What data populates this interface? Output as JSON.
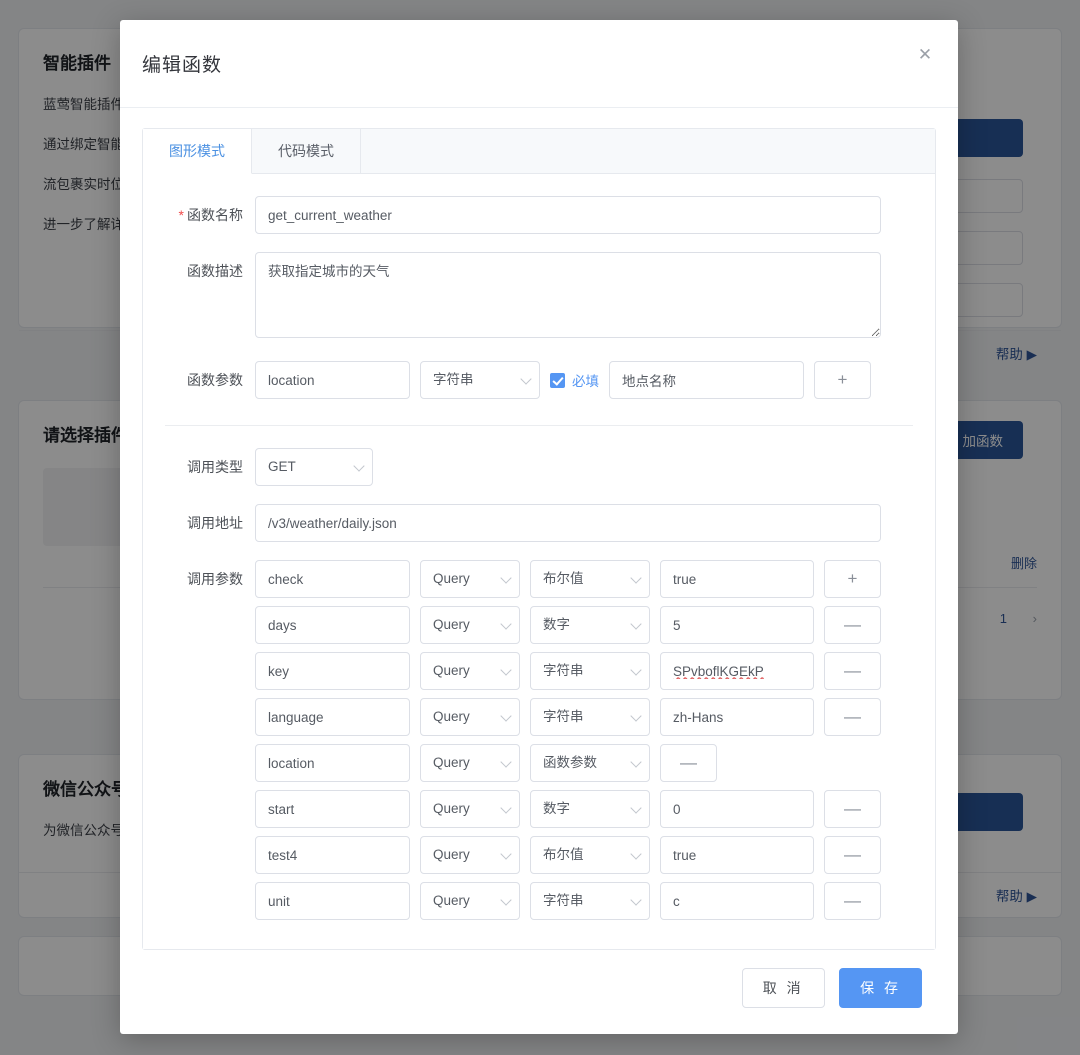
{
  "background": {
    "cards": [
      {
        "title": "智能插件",
        "lines": [
          "蓝莺智能插件",
          "通过绑定智能",
          "流包裹实时位",
          "进一步了解详"
        ],
        "footer_link": "帮助 ▶"
      },
      {
        "title": "请选择插件",
        "button_label": "加函数",
        "row_action": "删除",
        "pager_page": "1",
        "pager_next_icon": "chevron-right-icon"
      },
      {
        "title": "微信公众号",
        "lines": [
          "为微信公众号"
        ],
        "footer_link": "帮助 ▶"
      }
    ]
  },
  "modal": {
    "title": "编辑函数",
    "close_icon": "close-icon",
    "tabs": [
      {
        "label": "图形模式",
        "active": true
      },
      {
        "label": "代码模式",
        "active": false
      }
    ],
    "fields": {
      "name_label": "函数名称",
      "name_required": true,
      "name_value": "get_current_weather",
      "desc_label": "函数描述",
      "desc_value": "获取指定城市的天气",
      "params_label": "函数参数",
      "call_type_label": "调用类型",
      "call_type_value": "GET",
      "call_url_label": "调用地址",
      "call_url_value": "/v3/weather/daily.json",
      "call_params_label": "调用参数"
    },
    "function_params": [
      {
        "name": "location",
        "type": "字符串",
        "required": true,
        "required_label": "必填",
        "description": "地点名称",
        "action": "+"
      }
    ],
    "call_params": [
      {
        "name": "check",
        "in": "Query",
        "type": "布尔值",
        "value": "true",
        "action": "+",
        "has_value": true,
        "misspelled": false
      },
      {
        "name": "days",
        "in": "Query",
        "type": "数字",
        "value": "5",
        "action": "—",
        "has_value": true,
        "misspelled": false
      },
      {
        "name": "key",
        "in": "Query",
        "type": "字符串",
        "value": "SPvboflKGEkP",
        "action": "—",
        "has_value": true,
        "misspelled": true
      },
      {
        "name": "language",
        "in": "Query",
        "type": "字符串",
        "value": "zh-Hans",
        "action": "—",
        "has_value": true,
        "misspelled": false
      },
      {
        "name": "location",
        "in": "Query",
        "type": "函数参数",
        "value": "",
        "action": "—",
        "has_value": false,
        "misspelled": false
      },
      {
        "name": "start",
        "in": "Query",
        "type": "数字",
        "value": "0",
        "action": "—",
        "has_value": true,
        "misspelled": false
      },
      {
        "name": "test4",
        "in": "Query",
        "type": "布尔值",
        "value": "true",
        "action": "—",
        "has_value": true,
        "misspelled": false
      },
      {
        "name": "unit",
        "in": "Query",
        "type": "字符串",
        "value": "c",
        "action": "—",
        "has_value": true,
        "misspelled": false
      }
    ],
    "footer": {
      "cancel_label": "取 消",
      "save_label": "保 存"
    }
  },
  "colors": {
    "accent_blue": "#5596f3",
    "tab_active_blue": "#4a90e2",
    "required_red": "#f04a4a",
    "bg_button_navy": "#2a5699",
    "border_gray": "#dcdfe6"
  }
}
